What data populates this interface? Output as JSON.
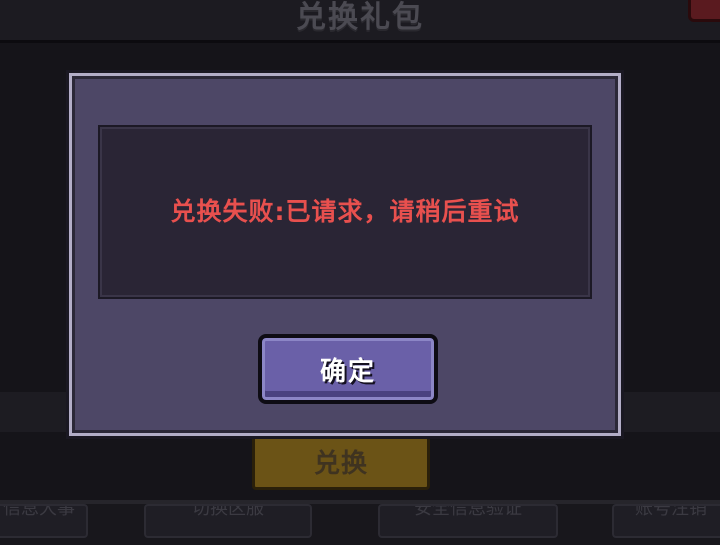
{
  "background": {
    "title": "兑换礼包",
    "redeem_button_label": "兑换",
    "bottom_tabs": [
      "信息大事",
      "切换区服",
      "安全信息验证",
      "账号注销"
    ]
  },
  "dialog": {
    "message": "兑换失败:已请求，请稍后重试",
    "confirm_label": "确定",
    "message_color": "#e8504e",
    "accent_color": "#6a60a8"
  }
}
